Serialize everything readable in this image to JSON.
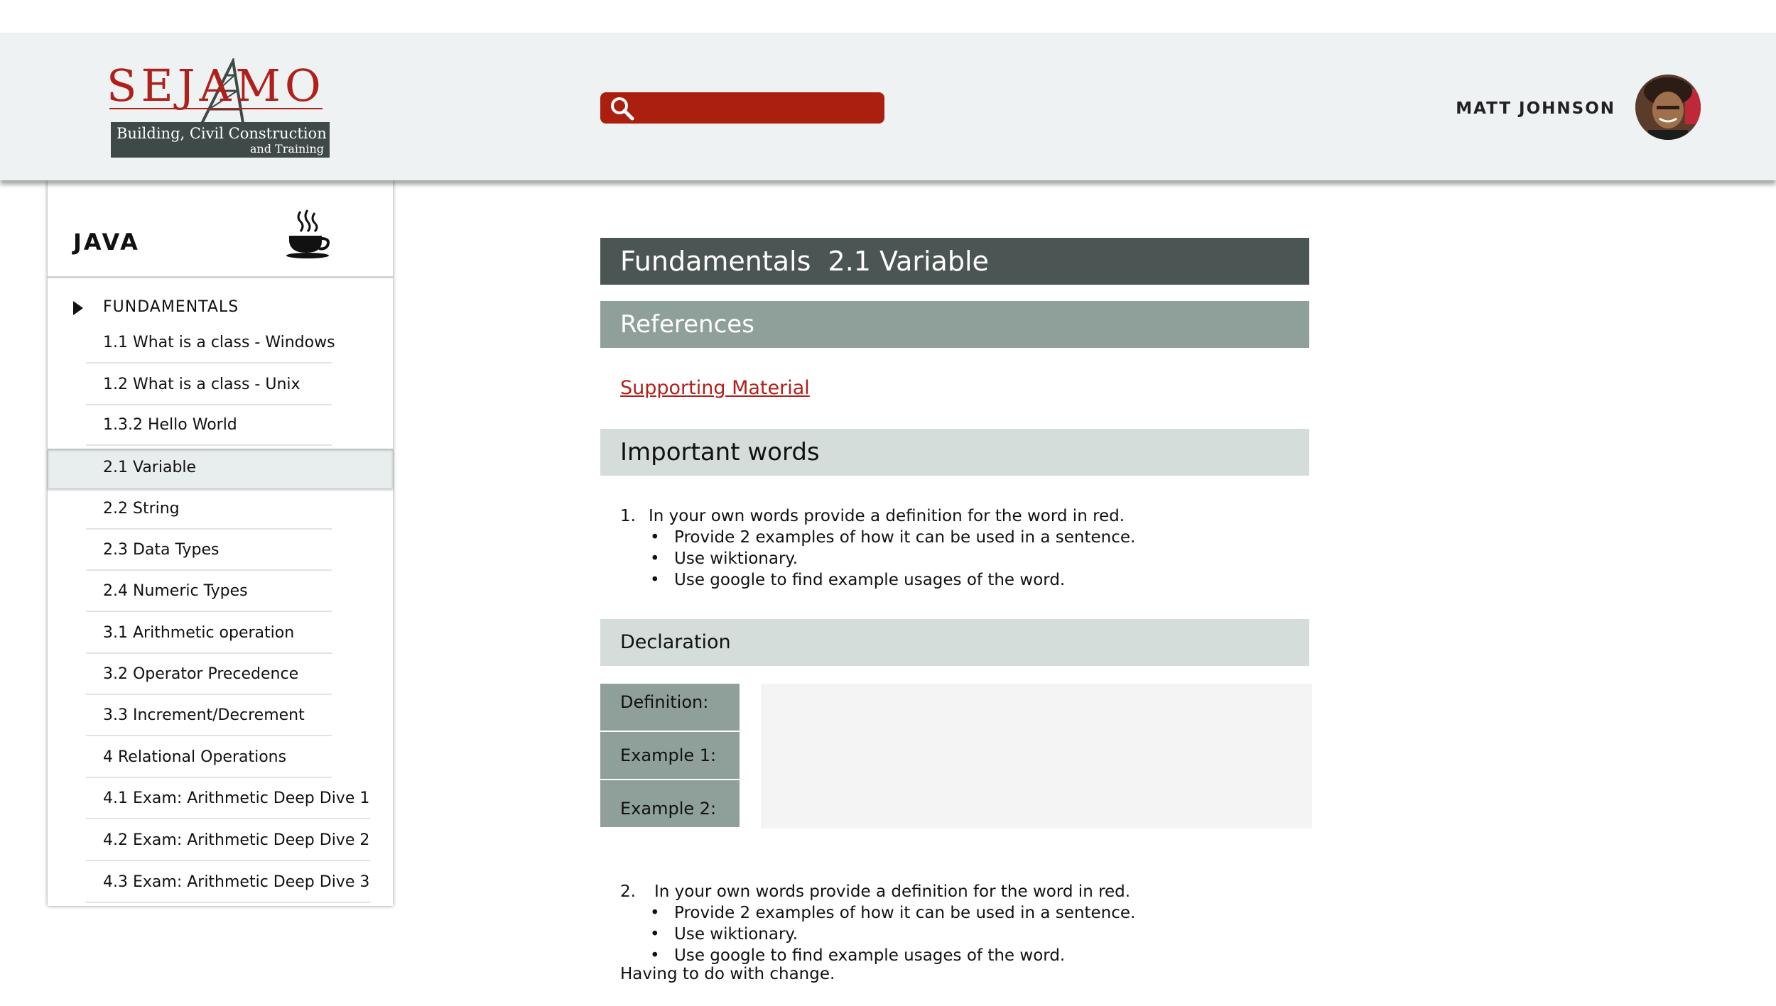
{
  "header": {
    "logo": {
      "brand": "SEJAMO",
      "tagline_1": "Building, Civil Construction",
      "tagline_2": "and Training"
    },
    "search": {
      "placeholder": "",
      "icon": "search-icon"
    },
    "user": {
      "name": "MATT JOHNSON"
    }
  },
  "sidebar": {
    "title": "JAVA",
    "title_icon": "coffee-cup-icon",
    "section": "FUNDAMENTALS",
    "items": [
      {
        "label": "1.1 What is a class - Windows",
        "active": false
      },
      {
        "label": "1.2  What is a class - Unix",
        "active": false
      },
      {
        "label": "1.3.2 Hello World",
        "active": false
      },
      {
        "label": "2.1 Variable",
        "active": true
      },
      {
        "label": "2.2 String",
        "active": false
      },
      {
        "label": "2.3 Data Types",
        "active": false
      },
      {
        "label": "2.4 Numeric Types",
        "active": false
      },
      {
        "label": "3.1 Arithmetic operation",
        "active": false
      },
      {
        "label": "3.2 Operator Precedence",
        "active": false
      },
      {
        "label": "3.3 Increment/Decrement",
        "active": false
      },
      {
        "label": "4 Relational Operations",
        "active": false
      },
      {
        "label": "4.1 Exam: Arithmetic Deep Dive 1",
        "active": false
      },
      {
        "label": "4.2 Exam: Arithmetic Deep Dive 2",
        "active": false
      },
      {
        "label": "4.3 Exam: Arithmetic Deep Dive 3",
        "active": false
      }
    ]
  },
  "main": {
    "title": "Fundamentals  2.1 Variable",
    "references_heading": "References",
    "supporting_link": "Supporting Material",
    "important_heading": "Important words",
    "question_1": {
      "number": "1.",
      "text": "In your own words provide a definition for the word in red.",
      "bullets": [
        "Provide 2 examples of how it can be used in a sentence.",
        "Use wiktionary.",
        "Use google to find example usages of the word."
      ]
    },
    "declaration_heading": "Declaration",
    "rows": [
      {
        "label": "Definition:",
        "value": ""
      },
      {
        "label": "Example 1:",
        "value": ""
      },
      {
        "label": "Example 2:",
        "value": ""
      }
    ],
    "question_2": {
      "number": "2.",
      "text": "In your own words provide a definition for the word in red.",
      "bullets": [
        "Provide 2 examples of how it can be used in a sentence.",
        "Use wiktionary.",
        "Use google to find example usages of the word."
      ]
    },
    "trailing_text": "Having to do with change."
  },
  "colors": {
    "brand_red": "#b0201a",
    "search_red": "#aa1f0e",
    "title_bar": "#4b5553",
    "ref_bar": "#8fa09a",
    "light_bar": "#d5dddb"
  }
}
